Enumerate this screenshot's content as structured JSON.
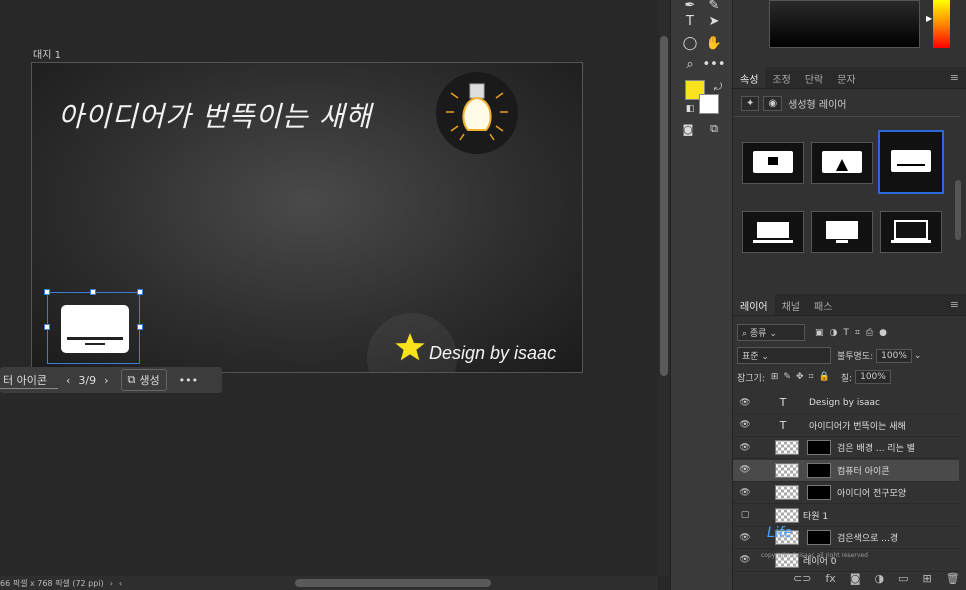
{
  "artboard": {
    "label": "대지 1",
    "title": "아이디어가 번뜩이는 새해",
    "credit": "Design by isaac"
  },
  "context_bar": {
    "layer_label": "터 아이콘",
    "page": "3/9",
    "generate_label": "생성",
    "more": "•••"
  },
  "status": {
    "doc_size": "66 픽셀 x 768 픽셀 (72 ppi)"
  },
  "colors": {
    "foreground": "#f7e21b",
    "background": "#ffffff",
    "selection": "#3b7ddd",
    "thumb_selected": "#2b6ad6"
  },
  "properties_panel": {
    "tabs": [
      "속성",
      "조정",
      "단락",
      "문자"
    ],
    "active_tab": "속성",
    "layer_type": "생성형 레이어"
  },
  "layers_panel": {
    "tabs": [
      "레이어",
      "채널",
      "패스"
    ],
    "active_tab": "레이어",
    "filter_label": "종류",
    "blend_mode": "표준",
    "opacity_label": "불투명도:",
    "opacity_value": "100%",
    "lock_label": "잠그기:",
    "fill_label": "칠:",
    "fill_value": "100%",
    "layers": [
      {
        "name": "Design by isaac",
        "kind": "text",
        "visible": true
      },
      {
        "name": "아이디어가 번뜩이는 새해",
        "kind": "text",
        "visible": true
      },
      {
        "name": "검은 배경 ... 리는 별",
        "kind": "generative",
        "visible": true
      },
      {
        "name": "컴퓨터 아이콘",
        "kind": "generative",
        "visible": true,
        "active": true
      },
      {
        "name": "아이디어 전구모양",
        "kind": "generative",
        "visible": true
      },
      {
        "name": "타원 1",
        "kind": "shape",
        "visible": false
      },
      {
        "name": "검은색으로 ...경",
        "kind": "generative",
        "visible": true
      },
      {
        "name": "레이어 0",
        "kind": "pixel",
        "visible": true
      }
    ]
  },
  "watermark": {
    "text": "Life",
    "copyright": "copyright © isaac all right reserved"
  }
}
